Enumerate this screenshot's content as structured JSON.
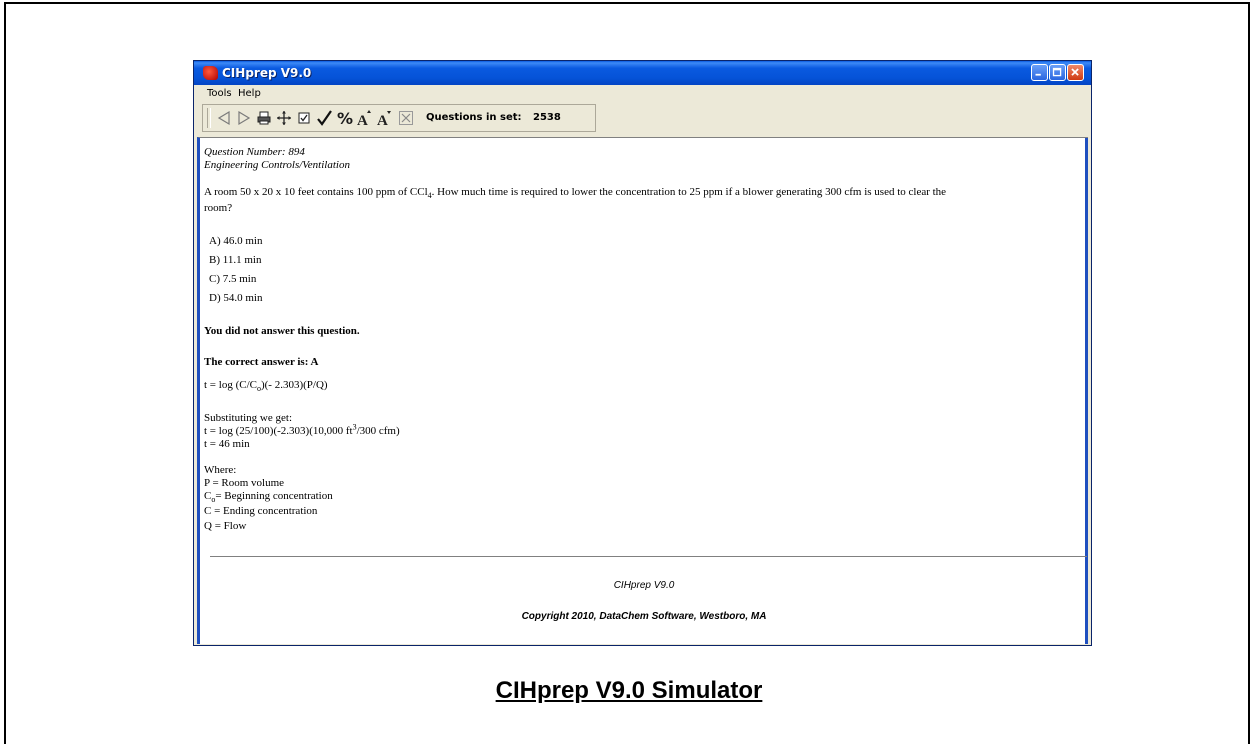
{
  "window": {
    "title": "CIHprep V9.0",
    "menu": [
      "Tools",
      "Help"
    ],
    "toolbar": {
      "icons": [
        "back-arrow-icon",
        "forward-arrow-icon",
        "printer-icon",
        "move-icon",
        "checkbox-icon",
        "checkmark-icon",
        "percent-icon",
        "font-increase-icon",
        "font-decrease-icon",
        "clear-icon"
      ],
      "questions_label": "Questions in set:",
      "questions_count": "2538"
    }
  },
  "question": {
    "number_line": "Question Number: 894",
    "category": "Engineering Controls/Ventilation",
    "text_part1": "A room 50 x 20 x 10 feet contains 100 ppm of CCl",
    "text_sub": "4",
    "text_part2": ".  How much time is required to lower the concentration to 25 ppm if a blower generating 300 cfm is used to clear the",
    "text_line2": "room?",
    "options": [
      "A) 46.0 min",
      "B) 11.1 min",
      "C) 7.5 min",
      "D) 54.0 min"
    ],
    "not_answered": "You did not answer this question.",
    "correct_answer": "The correct answer is: A",
    "formula_a": "t = log (C/C",
    "formula_sub": "o",
    "formula_b": ")(- 2.303)(P/Q)",
    "sub_heading": "Substituting we get:",
    "sub_line1_a": "t = log (25/100)(-2.303)(10,000 ft",
    "sub_line1_sup": "3",
    "sub_line1_b": "/300 cfm)",
    "sub_line2": "t = 46 min",
    "where": "Where:",
    "where_p": "P = Room volume",
    "where_co_a": "C",
    "where_co_sub": "o",
    "where_co_b": "= Beginning concentration",
    "where_c": "C = Ending concentration",
    "where_q": "Q = Flow"
  },
  "footer": {
    "title": "CIHprep V9.0",
    "copyright": "Copyright 2010, DataChem Software, Westboro, MA"
  },
  "caption": "CIHprep V9.0 Simulator"
}
